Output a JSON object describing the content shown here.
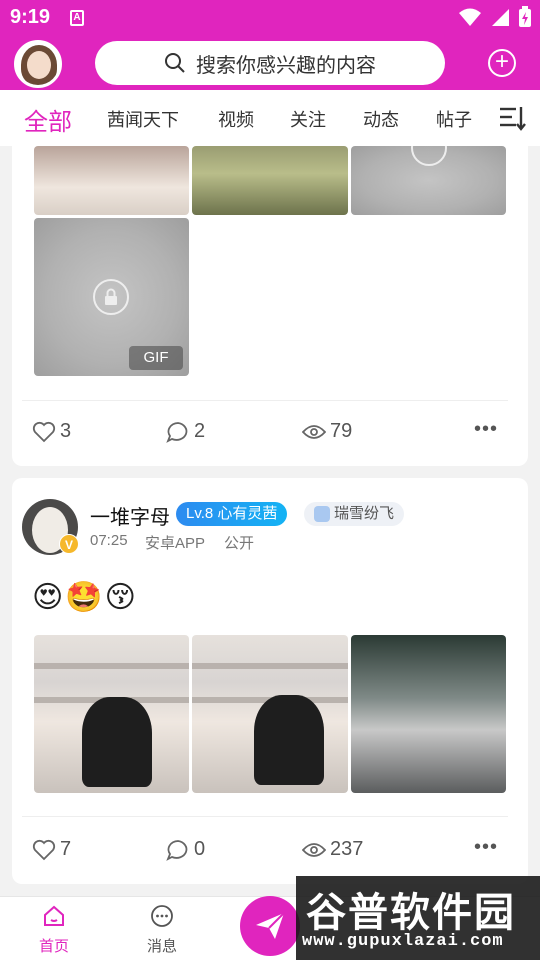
{
  "status_bar": {
    "time": "9:19",
    "app_icon": "A"
  },
  "header": {
    "search_placeholder": "搜索你感兴趣的内容",
    "add_icon": "plus-circle-icon"
  },
  "tabs": [
    {
      "label": "全部",
      "active": true
    },
    {
      "label": "茜闻天下",
      "active": false
    },
    {
      "label": "视频",
      "active": false
    },
    {
      "label": "关注",
      "active": false
    },
    {
      "label": "动态",
      "active": false
    },
    {
      "label": "帖子",
      "active": false
    }
  ],
  "post1": {
    "gif_label": "GIF",
    "likes": "3",
    "comments": "2",
    "views": "79"
  },
  "post2": {
    "username": "一堆字母",
    "level": "Lv.8 心有灵茜",
    "tag": "瑞雪纷飞",
    "time": "07:25",
    "source": "安卓APP",
    "visibility": "公开",
    "emojis": "😍🤩😚",
    "likes": "7",
    "comments": "0",
    "views": "237"
  },
  "bottom_nav": [
    {
      "label": "首页",
      "active": true
    },
    {
      "label": "消息",
      "active": false
    }
  ],
  "watermark": {
    "title": "谷普软件园",
    "url": "www.gupuxlazai.com"
  },
  "colors": {
    "accent": "#e025be",
    "level_badge": "#1e9cf2"
  }
}
